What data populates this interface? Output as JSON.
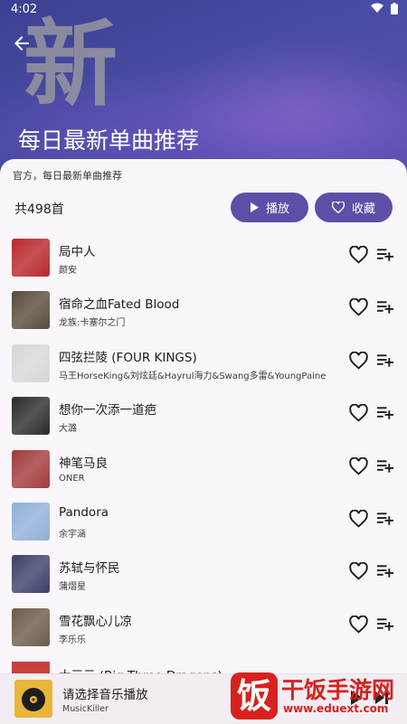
{
  "status": {
    "time": "4:02"
  },
  "hero": {
    "big_char": "新",
    "title": "每日最新单曲推荐"
  },
  "sheet": {
    "subtitle": "官方，每日最新单曲推荐",
    "count": "共498首",
    "play_label": "播放",
    "fav_label": "收藏"
  },
  "songs": [
    {
      "title": "局中人",
      "artist": "颜安",
      "cover": "#b8262a"
    },
    {
      "title": "宿命之血Fated Blood",
      "artist": "龙族:卡塞尔之门",
      "cover": "#5a4a3c"
    },
    {
      "title": "四弦拦陵 (FOUR KINGS)",
      "artist": "马王HorseKing&刘炫廷&Hayrul海力&Swang多雷&YoungPaine",
      "cover": "#d8d6d6"
    },
    {
      "title": "想你一次添一道疤",
      "artist": "大潞",
      "cover": "#2b2b2b"
    },
    {
      "title": "神笔马良",
      "artist": "ONER",
      "cover": "#a23a3a"
    },
    {
      "title": "Pandora",
      "artist": "余宇涵",
      "cover": "#8fb0d8"
    },
    {
      "title": "苏轼与怀民",
      "artist": "蒲熠星",
      "cover": "#3c3f6a"
    },
    {
      "title": "雪花飘心儿凉",
      "artist": "李乐乐",
      "cover": "#6b5a4a"
    }
  ],
  "partial_song": {
    "title": "大三元 (Big Three Dragons)"
  },
  "player": {
    "title": "请选择音乐播放",
    "subtitle": "MusicKiller"
  },
  "watermark": {
    "logo_char": "饭",
    "name": "干饭手游网",
    "url": "www.eduext.com"
  }
}
